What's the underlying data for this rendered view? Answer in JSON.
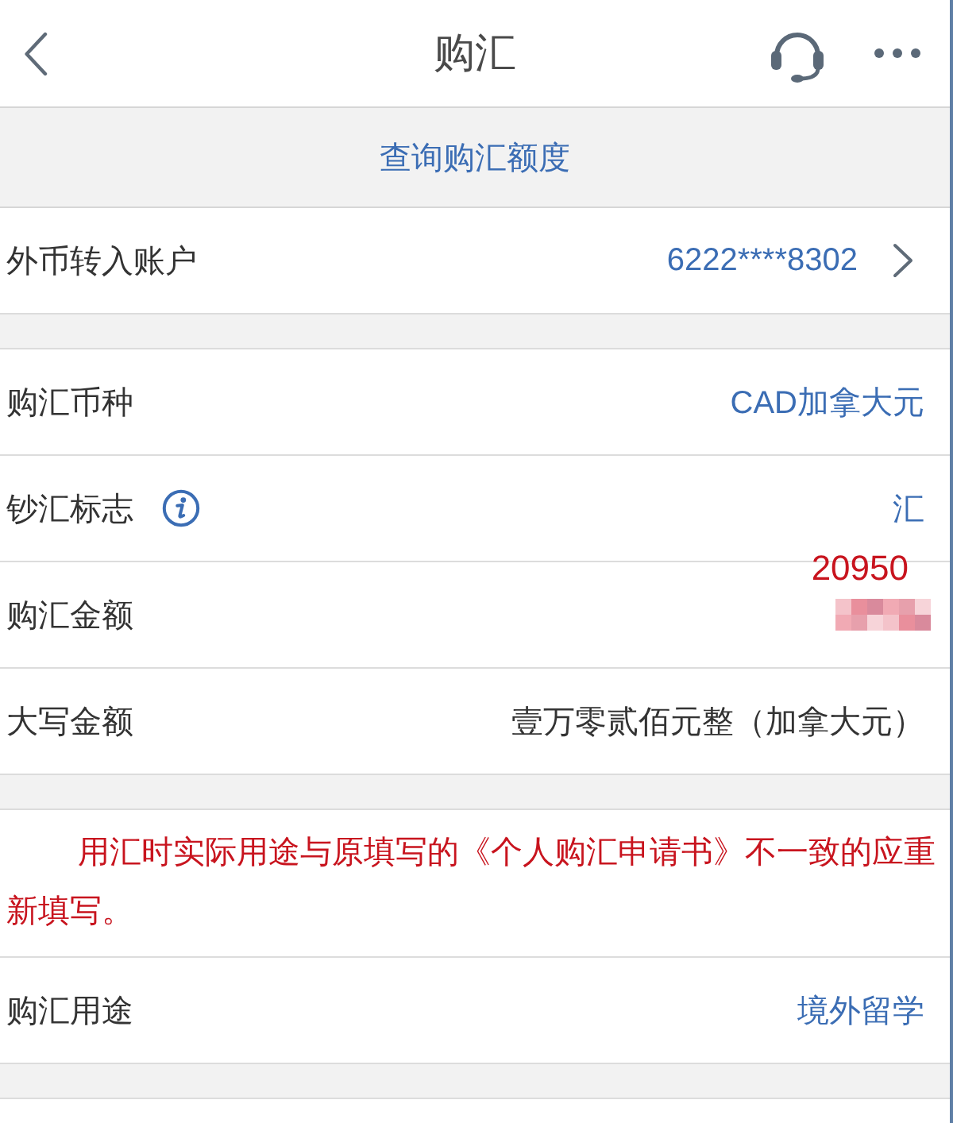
{
  "nav": {
    "title": "购汇"
  },
  "quota_link": {
    "label": "查询购汇额度"
  },
  "sections": [
    {
      "rows": [
        {
          "kind": "select",
          "label": "外币转入账户",
          "info": false,
          "value": "6222****8302",
          "chevron": true
        }
      ]
    },
    {
      "rows": [
        {
          "kind": "select",
          "label": "购汇币种",
          "info": false,
          "value": "CAD加拿大元",
          "chevron": false
        },
        {
          "kind": "select",
          "label": "钞汇标志",
          "info": true,
          "value": "汇",
          "chevron": false
        },
        {
          "kind": "masked",
          "label": "购汇金额",
          "info": false,
          "annotation": "20950",
          "chevron": false
        },
        {
          "kind": "plain",
          "label": "大写金额",
          "info": false,
          "value": "壹万零贰佰元整（加拿大元）",
          "chevron": false
        }
      ]
    },
    {
      "notice": "用汇时实际用途与原填写的《个人购汇申请书》不一致的应重新填写。",
      "rows": [
        {
          "kind": "select",
          "label": "购汇用途",
          "info": false,
          "value": "境外留学",
          "chevron": false
        }
      ]
    }
  ]
}
